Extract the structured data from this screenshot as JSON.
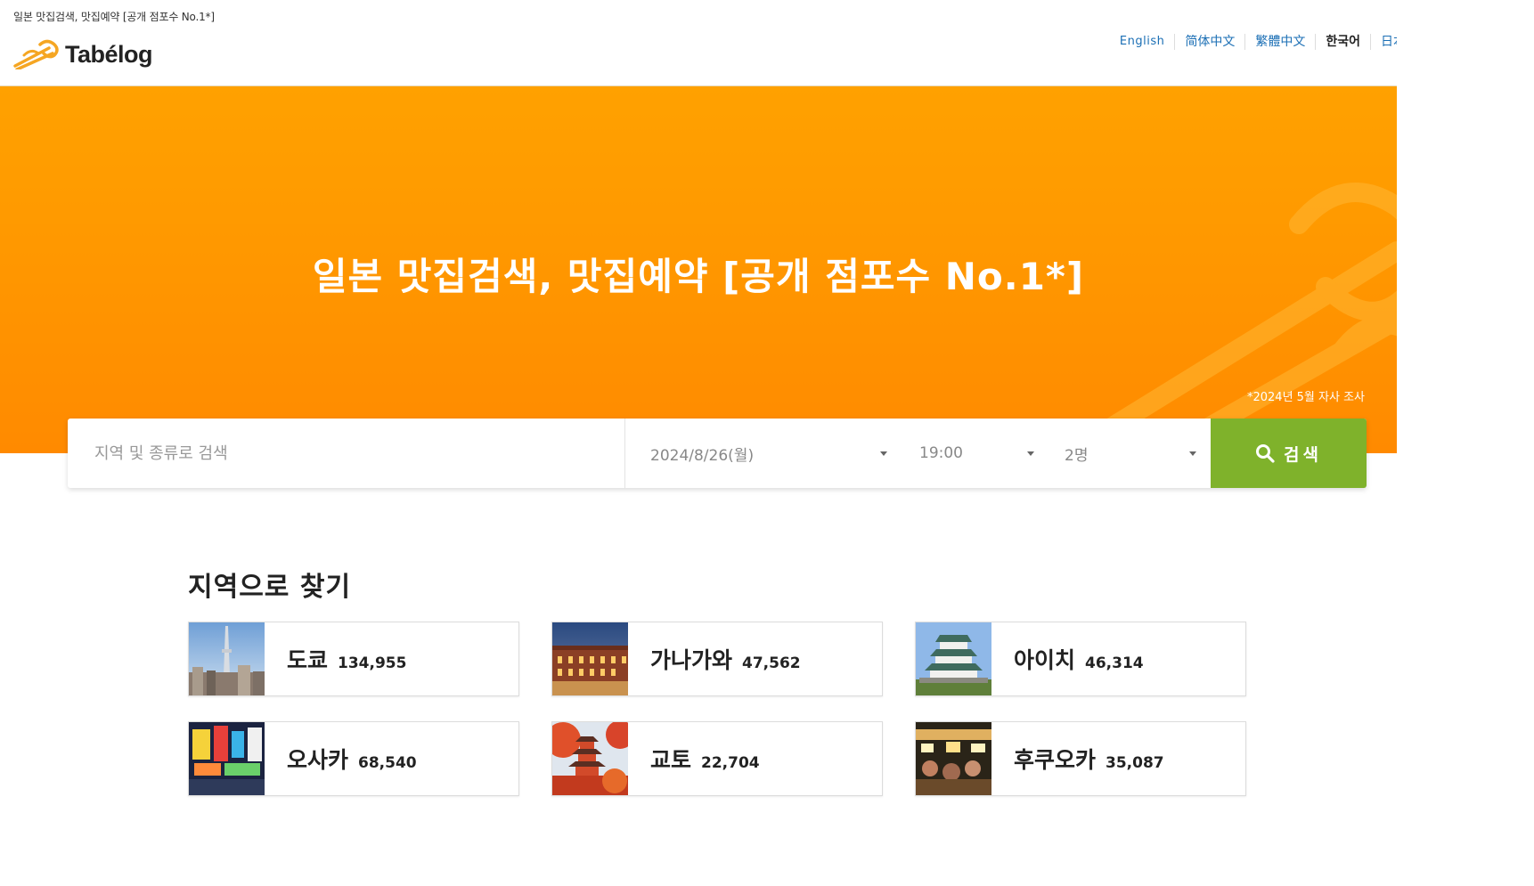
{
  "header": {
    "tagline": "일본 맛집검색, 맛집예약 [공개 점포수 No.1*]",
    "logo_text": "Tabélog",
    "logo_icon": "chopsticks-icon",
    "languages": [
      {
        "label": "English",
        "current": false
      },
      {
        "label": "简体中文",
        "current": false
      },
      {
        "label": "繁體中文",
        "current": false
      },
      {
        "label": "한국어",
        "current": true
      },
      {
        "label": "日本語",
        "current": false
      }
    ]
  },
  "hero": {
    "title": "일본 맛집검색, 맛집예약 [공개 점포수 No.1*]",
    "note": "*2024년 5월 자사 조사",
    "background_color": "#ff9a00"
  },
  "search": {
    "keyword_placeholder": "지역 및 종류로 검색",
    "date": "2024/8/26(월)",
    "time": "19:00",
    "people": "2명",
    "button_label": "검색",
    "button_icon": "search-icon",
    "button_color": "#7fb22b"
  },
  "areas": {
    "heading": "지역으로 찾기",
    "items": [
      {
        "name": "도쿄",
        "count": "134,955",
        "image": "tokyo-skytree-photo"
      },
      {
        "name": "가나가와",
        "count": "47,562",
        "image": "yokohama-warehouse-photo"
      },
      {
        "name": "아이치",
        "count": "46,314",
        "image": "nagoya-castle-photo"
      },
      {
        "name": "오사카",
        "count": "68,540",
        "image": "dotonbori-signs-photo"
      },
      {
        "name": "교토",
        "count": "22,704",
        "image": "kyoto-pagoda-photo"
      },
      {
        "name": "후쿠오카",
        "count": "35,087",
        "image": "fukuoka-yatai-photo"
      }
    ]
  }
}
